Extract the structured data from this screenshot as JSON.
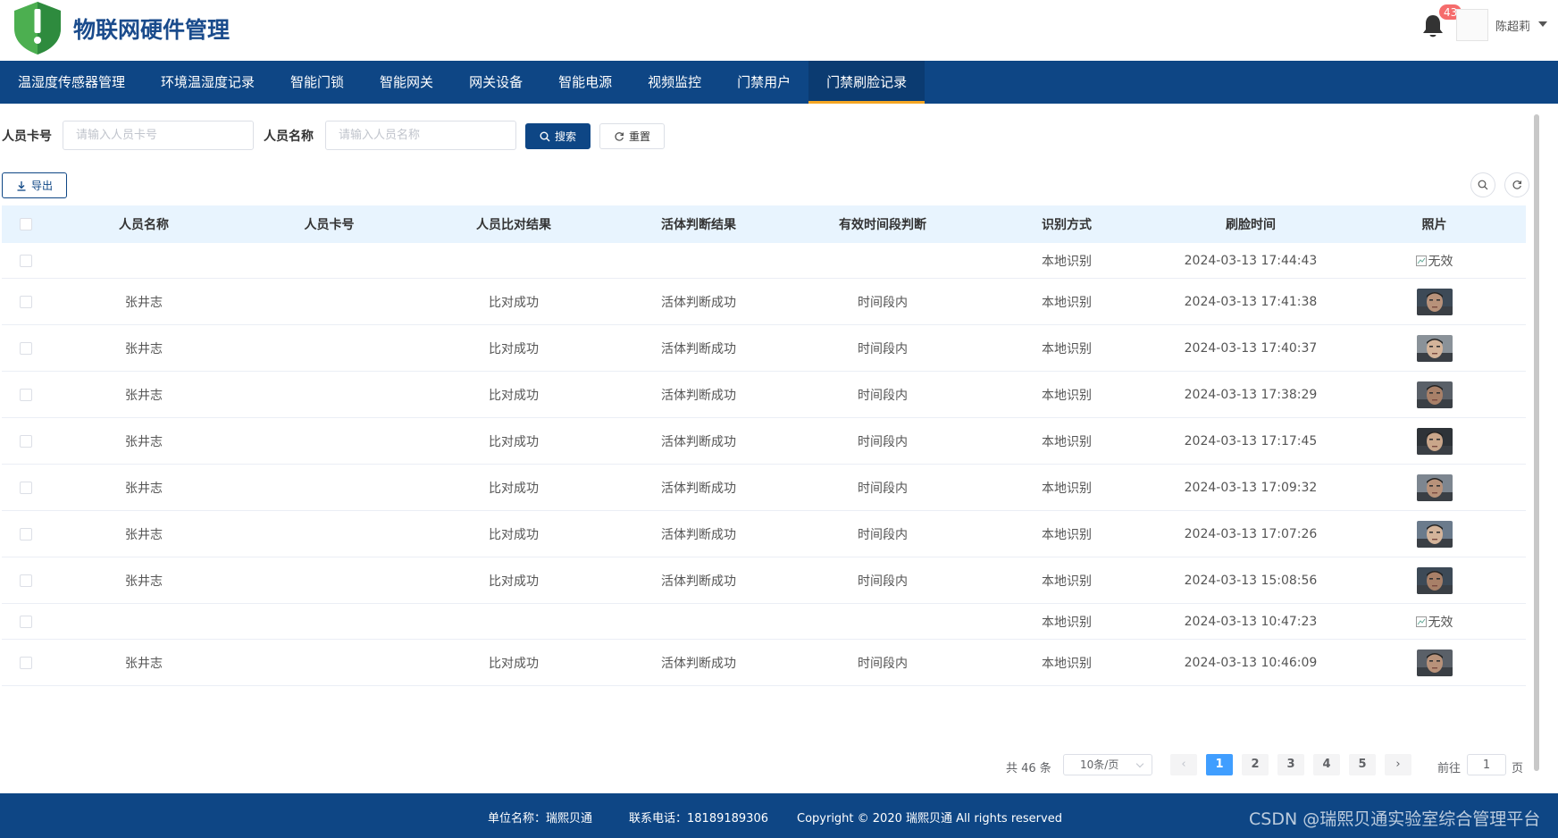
{
  "header": {
    "app_title": "物联网硬件管理",
    "notification_count": "43",
    "user_name": "陈超莉"
  },
  "nav": {
    "items": [
      {
        "label": "温湿度传感器管理"
      },
      {
        "label": "环境温湿度记录"
      },
      {
        "label": "智能门锁"
      },
      {
        "label": "智能网关"
      },
      {
        "label": "网关设备"
      },
      {
        "label": "智能电源"
      },
      {
        "label": "视频监控"
      },
      {
        "label": "门禁用户"
      },
      {
        "label": "门禁刷脸记录"
      }
    ],
    "active_index": 8
  },
  "filters": {
    "card_label": "人员卡号",
    "card_placeholder": "请输入人员卡号",
    "name_label": "人员名称",
    "name_placeholder": "请输入人员名称",
    "search_label": "搜索",
    "reset_label": "重置"
  },
  "toolbar": {
    "export_label": "导出"
  },
  "table": {
    "columns": [
      "人员名称",
      "人员卡号",
      "人员比对结果",
      "活体判断结果",
      "有效时间段判断",
      "识别方式",
      "刷脸时间",
      "照片"
    ],
    "rows": [
      {
        "name": "",
        "card": "",
        "compare": "",
        "liveness": "",
        "period": "",
        "method": "本地识别",
        "time": "2024-03-13 17:44:43",
        "photo": "无效"
      },
      {
        "name": "张井志",
        "card": "",
        "compare": "比对成功",
        "liveness": "活体判断成功",
        "period": "时间段内",
        "method": "本地识别",
        "time": "2024-03-13 17:41:38",
        "photo": "face"
      },
      {
        "name": "张井志",
        "card": "",
        "compare": "比对成功",
        "liveness": "活体判断成功",
        "period": "时间段内",
        "method": "本地识别",
        "time": "2024-03-13 17:40:37",
        "photo": "face"
      },
      {
        "name": "张井志",
        "card": "",
        "compare": "比对成功",
        "liveness": "活体判断成功",
        "period": "时间段内",
        "method": "本地识别",
        "time": "2024-03-13 17:38:29",
        "photo": "face"
      },
      {
        "name": "张井志",
        "card": "",
        "compare": "比对成功",
        "liveness": "活体判断成功",
        "period": "时间段内",
        "method": "本地识别",
        "time": "2024-03-13 17:17:45",
        "photo": "face"
      },
      {
        "name": "张井志",
        "card": "",
        "compare": "比对成功",
        "liveness": "活体判断成功",
        "period": "时间段内",
        "method": "本地识别",
        "time": "2024-03-13 17:09:32",
        "photo": "face"
      },
      {
        "name": "张井志",
        "card": "",
        "compare": "比对成功",
        "liveness": "活体判断成功",
        "period": "时间段内",
        "method": "本地识别",
        "time": "2024-03-13 17:07:26",
        "photo": "face"
      },
      {
        "name": "张井志",
        "card": "",
        "compare": "比对成功",
        "liveness": "活体判断成功",
        "period": "时间段内",
        "method": "本地识别",
        "time": "2024-03-13 15:08:56",
        "photo": "face"
      },
      {
        "name": "",
        "card": "",
        "compare": "",
        "liveness": "",
        "period": "",
        "method": "本地识别",
        "time": "2024-03-13 10:47:23",
        "photo": "无效"
      },
      {
        "name": "张井志",
        "card": "",
        "compare": "比对成功",
        "liveness": "活体判断成功",
        "period": "时间段内",
        "method": "本地识别",
        "time": "2024-03-13 10:46:09",
        "photo": "face"
      }
    ]
  },
  "pagination": {
    "total_text": "共 46 条",
    "page_size": "10条/页",
    "pages": [
      "1",
      "2",
      "3",
      "4",
      "5"
    ],
    "current_page": "1",
    "goto_label": "前往",
    "goto_value": "1",
    "page_suffix": "页"
  },
  "footer": {
    "unit": "单位名称：瑞熙贝通",
    "phone": "联系电话：18189189306",
    "copyright": "Copyright © 2020 瑞熙贝通 All rights reserved",
    "watermark": "CSDN @瑞熙贝通实验室综合管理平台"
  },
  "colors": {
    "primary": "#0e4685",
    "nav_active_underline": "#f5a623",
    "table_header_bg": "#e8f4fe",
    "badge": "#f56c6c",
    "page_active": "#409eff"
  }
}
